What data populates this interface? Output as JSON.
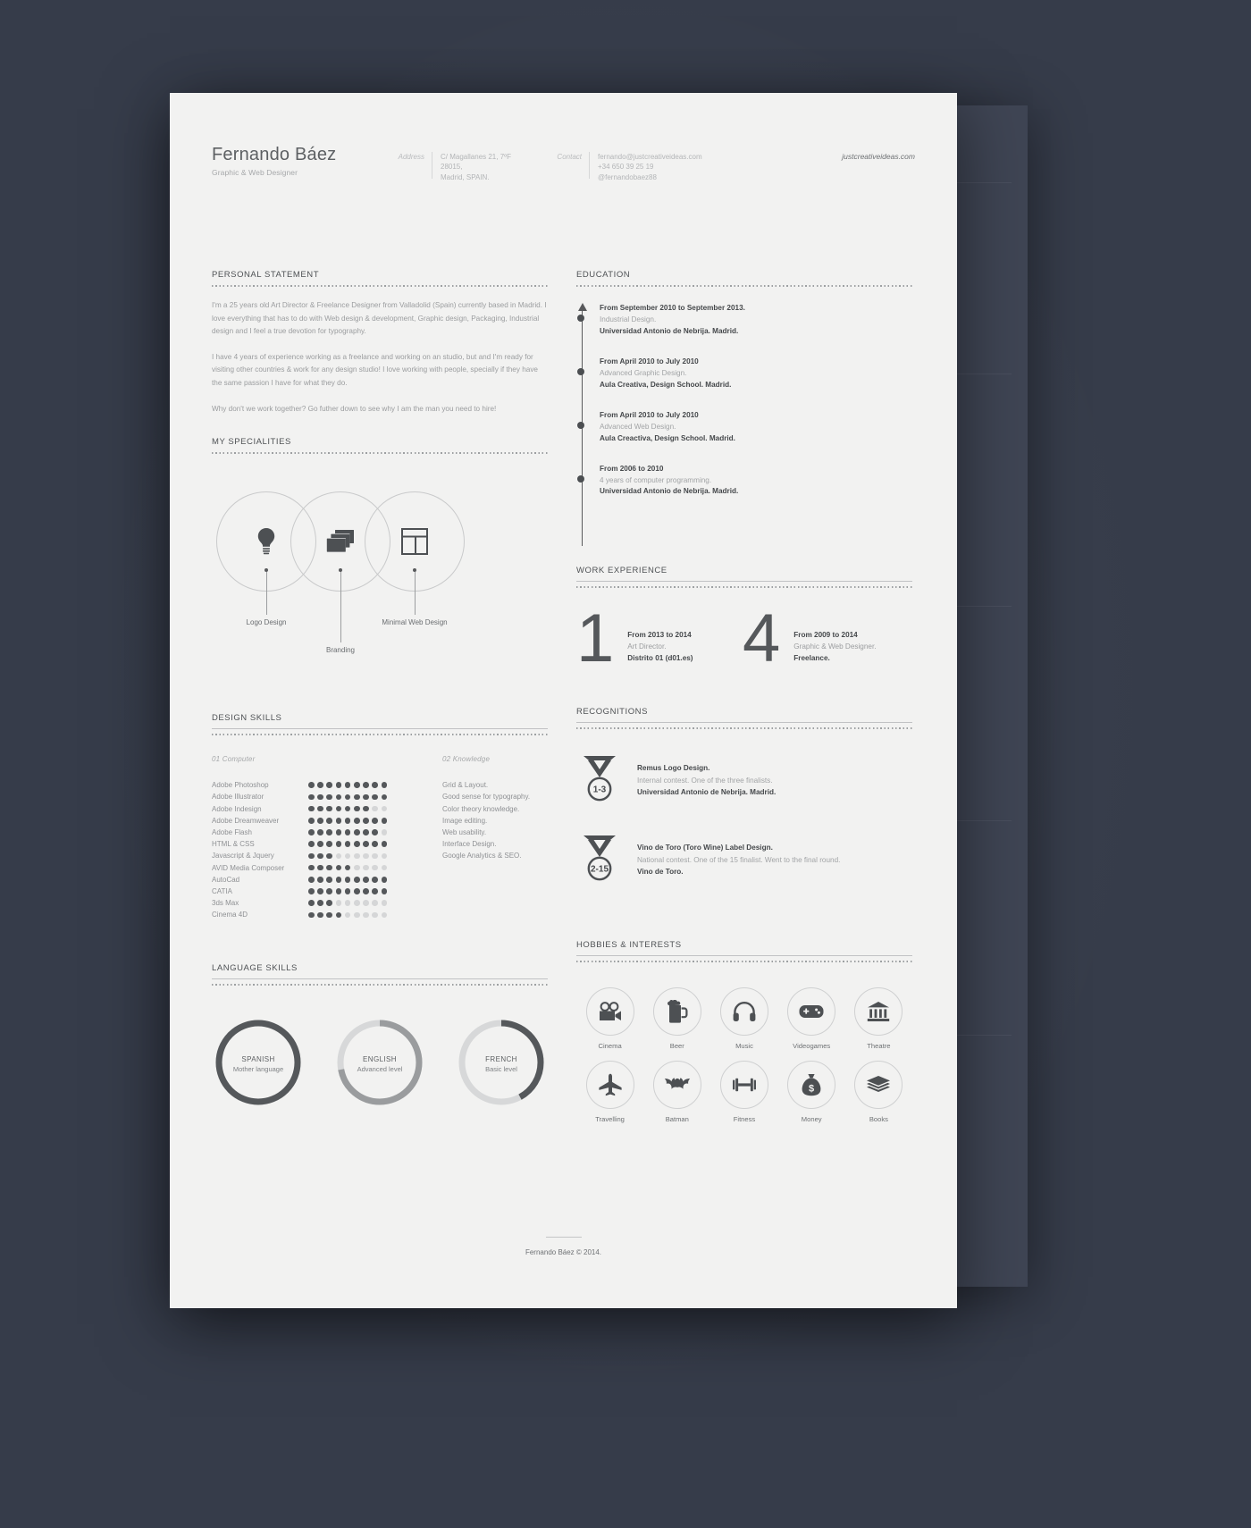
{
  "header": {
    "name": "Fernando Báez",
    "role": "Graphic & Web Designer",
    "address_label": "Address",
    "address_lines": "C/ Magallanes 21, 7ºF\n28015,\nMadrid, SPAIN.",
    "contact_label": "Contact",
    "contact_lines": "fernando@justcreativeideas.com\n+34 650 39 25 19\n@fernandobaez88",
    "website": "justcreativeideas.com"
  },
  "personal_statement": {
    "title": "PERSONAL STATEMENT",
    "paragraphs": [
      "I'm a 25 years old Art Director & Freelance Designer from Valladolid (Spain) currently based in Madrid. I love everything that has to do with Web design & development, Graphic design, Packaging, Industrial design and I feel a true devotion for typography.",
      "I have 4 years of experience working as a freelance and working on an studio, but and I'm ready for visiting other countries & work for any design studio! I love working with people, specially if they have the same passion I have for what they do.",
      "Why don't we work together? Go futher down to see why I am the man you need to hire!"
    ]
  },
  "specialities": {
    "title": "MY SPECIALITIES",
    "items": [
      {
        "label": "Logo Design",
        "icon": "lightbulb-icon"
      },
      {
        "label": "Branding",
        "icon": "layers-icon"
      },
      {
        "label": "Minimal Web Design",
        "icon": "layout-icon"
      }
    ]
  },
  "design_skills": {
    "title": "DESIGN SKILLS",
    "col1_label": "01 Computer",
    "col2_label": "02 Knowledge",
    "max_dots": 9,
    "computer": [
      {
        "name": "Adobe Photoshop",
        "level": 9
      },
      {
        "name": "Adobe Illustrator",
        "level": 9
      },
      {
        "name": "Adobe Indesign",
        "level": 7
      },
      {
        "name": "Adobe Dreamweaver",
        "level": 9
      },
      {
        "name": "Adobe Flash",
        "level": 8
      },
      {
        "name": "HTML & CSS",
        "level": 9
      },
      {
        "name": "Javascript & Jquery",
        "level": 3
      },
      {
        "name": "AVID Media Composer",
        "level": 5
      },
      {
        "name": "AutoCad",
        "level": 9
      },
      {
        "name": "CATIA",
        "level": 9
      },
      {
        "name": "3ds Max",
        "level": 3
      },
      {
        "name": "Cinema 4D",
        "level": 4
      }
    ],
    "knowledge": [
      "Grid & Layout.",
      "Good sense for typography.",
      "Color theory knowledge.",
      "Image editing.",
      "Web usability.",
      "Interface Design.",
      "Google Analytics & SEO."
    ]
  },
  "language_skills": {
    "title": "LANGUAGE SKILLS",
    "items": [
      {
        "name": "SPANISH",
        "level_text": "Mother language",
        "percent": 100,
        "color": "#55585b"
      },
      {
        "name": "ENGLISH",
        "level_text": "Advanced level",
        "percent": 72,
        "color": "#9a9c9e"
      },
      {
        "name": "FRENCH",
        "level_text": "Basic level",
        "percent": 42,
        "color": "#55585b"
      }
    ]
  },
  "education": {
    "title": "EDUCATION",
    "items": [
      {
        "date": "From September 2010 to September 2013.",
        "what": "Industrial Design.",
        "where": "Universidad Antonio de Nebrija. Madrid."
      },
      {
        "date": "From April 2010 to July 2010",
        "what": "Advanced Graphic Design.",
        "where": "Aula Creativa, Design School. Madrid."
      },
      {
        "date": "From April 2010 to July 2010",
        "what": "Advanced Web Design.",
        "where": "Aula Creactiva, Design School. Madrid."
      },
      {
        "date": "From 2006 to 2010",
        "what": "4 years of computer programming.",
        "where": "Universidad Antonio de Nebrija. Madrid."
      }
    ]
  },
  "work_experience": {
    "title": "WORK EXPERIENCE",
    "items": [
      {
        "number": "1",
        "line1": "From 2013 to 2014",
        "line2": "Art Director.",
        "line3": "Distrito 01 (d01.es)"
      },
      {
        "number": "4",
        "line1": "From 2009 to 2014",
        "line2": "Graphic & Web Designer.",
        "line3": "Freelance."
      }
    ]
  },
  "recognitions": {
    "title": "RECOGNITIONS",
    "items": [
      {
        "badge": "1-3",
        "line1": "Remus Logo Design.",
        "line2": "Internal contest. One of the three finalists.",
        "line3": "Universidad Antonio de Nebrija. Madrid."
      },
      {
        "badge": "2-15",
        "line1": "Vino de Toro (Toro Wine) Label Design.",
        "line2": "National contest. One of the 15 finalist. Went to the final round.",
        "line3": "Vino de Toro."
      }
    ]
  },
  "hobbies": {
    "title": "HOBBIES & INTERESTS",
    "items": [
      {
        "label": "Cinema",
        "icon": "film-camera-icon"
      },
      {
        "label": "Beer",
        "icon": "beer-mug-icon"
      },
      {
        "label": "Music",
        "icon": "headphones-icon"
      },
      {
        "label": "Videogames",
        "icon": "gamepad-icon"
      },
      {
        "label": "Theatre",
        "icon": "classical-building-icon"
      },
      {
        "label": "Travelling",
        "icon": "airplane-icon"
      },
      {
        "label": "Batman",
        "icon": "bat-icon"
      },
      {
        "label": "Fitness",
        "icon": "dumbbell-icon"
      },
      {
        "label": "Money",
        "icon": "money-bag-icon"
      },
      {
        "label": "Books",
        "icon": "books-icon"
      }
    ]
  },
  "footer": {
    "text": "Fernando Báez © 2014."
  }
}
